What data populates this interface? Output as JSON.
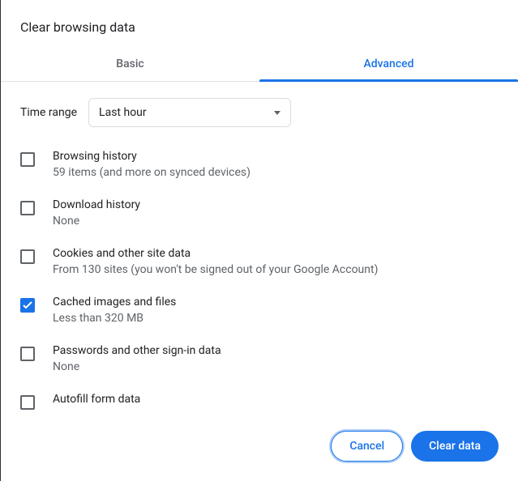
{
  "dialog": {
    "title": "Clear browsing data"
  },
  "tabs": {
    "basic": "Basic",
    "advanced": "Advanced"
  },
  "timeRange": {
    "label": "Time range",
    "value": "Last hour"
  },
  "options": [
    {
      "title": "Browsing history",
      "sub": "59 items (and more on synced devices)",
      "checked": false
    },
    {
      "title": "Download history",
      "sub": "None",
      "checked": false
    },
    {
      "title": "Cookies and other site data",
      "sub": "From 130 sites (you won't be signed out of your Google Account)",
      "checked": false
    },
    {
      "title": "Cached images and files",
      "sub": "Less than 320 MB",
      "checked": true
    },
    {
      "title": "Passwords and other sign-in data",
      "sub": "None",
      "checked": false
    },
    {
      "title": "Autofill form data",
      "sub": "",
      "checked": false
    }
  ],
  "footer": {
    "cancel": "Cancel",
    "confirm": "Clear data"
  }
}
